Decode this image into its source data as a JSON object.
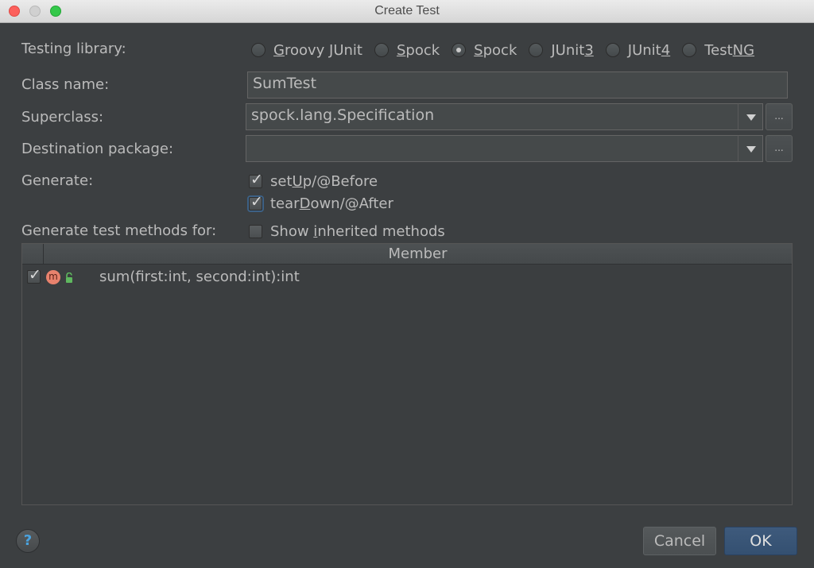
{
  "window": {
    "title": "Create Test"
  },
  "form": {
    "testing_library_label": "Testing library:",
    "class_name_label": "Class name:",
    "superclass_label": "Superclass:",
    "destination_package_label": "Destination package:",
    "generate_label": "Generate:",
    "generate_test_methods_label": "Generate test methods for:"
  },
  "libraries": [
    {
      "pre": "",
      "ul": "G",
      "post": "roovy JUnit",
      "selected": false
    },
    {
      "pre": "",
      "ul": "S",
      "post": "pock",
      "selected": false
    },
    {
      "pre": "",
      "ul": "S",
      "post": "pock",
      "selected": true
    },
    {
      "pre": "JUnit",
      "ul": "3",
      "post": "",
      "selected": false
    },
    {
      "pre": "JUnit",
      "ul": "4",
      "post": "",
      "selected": false
    },
    {
      "pre": "Test",
      "ul": "NG",
      "post": "",
      "selected": false
    }
  ],
  "class_name": {
    "value": "SumTest"
  },
  "superclass": {
    "value": "spock.lang.Specification",
    "browse_label": "..."
  },
  "destination_package": {
    "value": "",
    "browse_label": "..."
  },
  "generate": {
    "setup": {
      "pre": "set",
      "ul": "U",
      "post": "p/@Before",
      "checked": true
    },
    "teardown": {
      "pre": "tear",
      "ul": "D",
      "post": "own/@After",
      "checked": true
    }
  },
  "show_inherited": {
    "pre": "Show ",
    "ul": "i",
    "post": "nherited methods",
    "checked": false
  },
  "members_table": {
    "header": "Member",
    "rows": [
      {
        "icon": "m",
        "signature": "sum(first:int, second:int):int",
        "checked": true
      }
    ]
  },
  "buttons": {
    "help": "?",
    "cancel": "Cancel",
    "ok": "OK"
  },
  "colors": {
    "background": "#3c3f41",
    "ok_button": "#365880",
    "method_icon": "#e8826d",
    "lock_icon": "#5fb85f"
  }
}
